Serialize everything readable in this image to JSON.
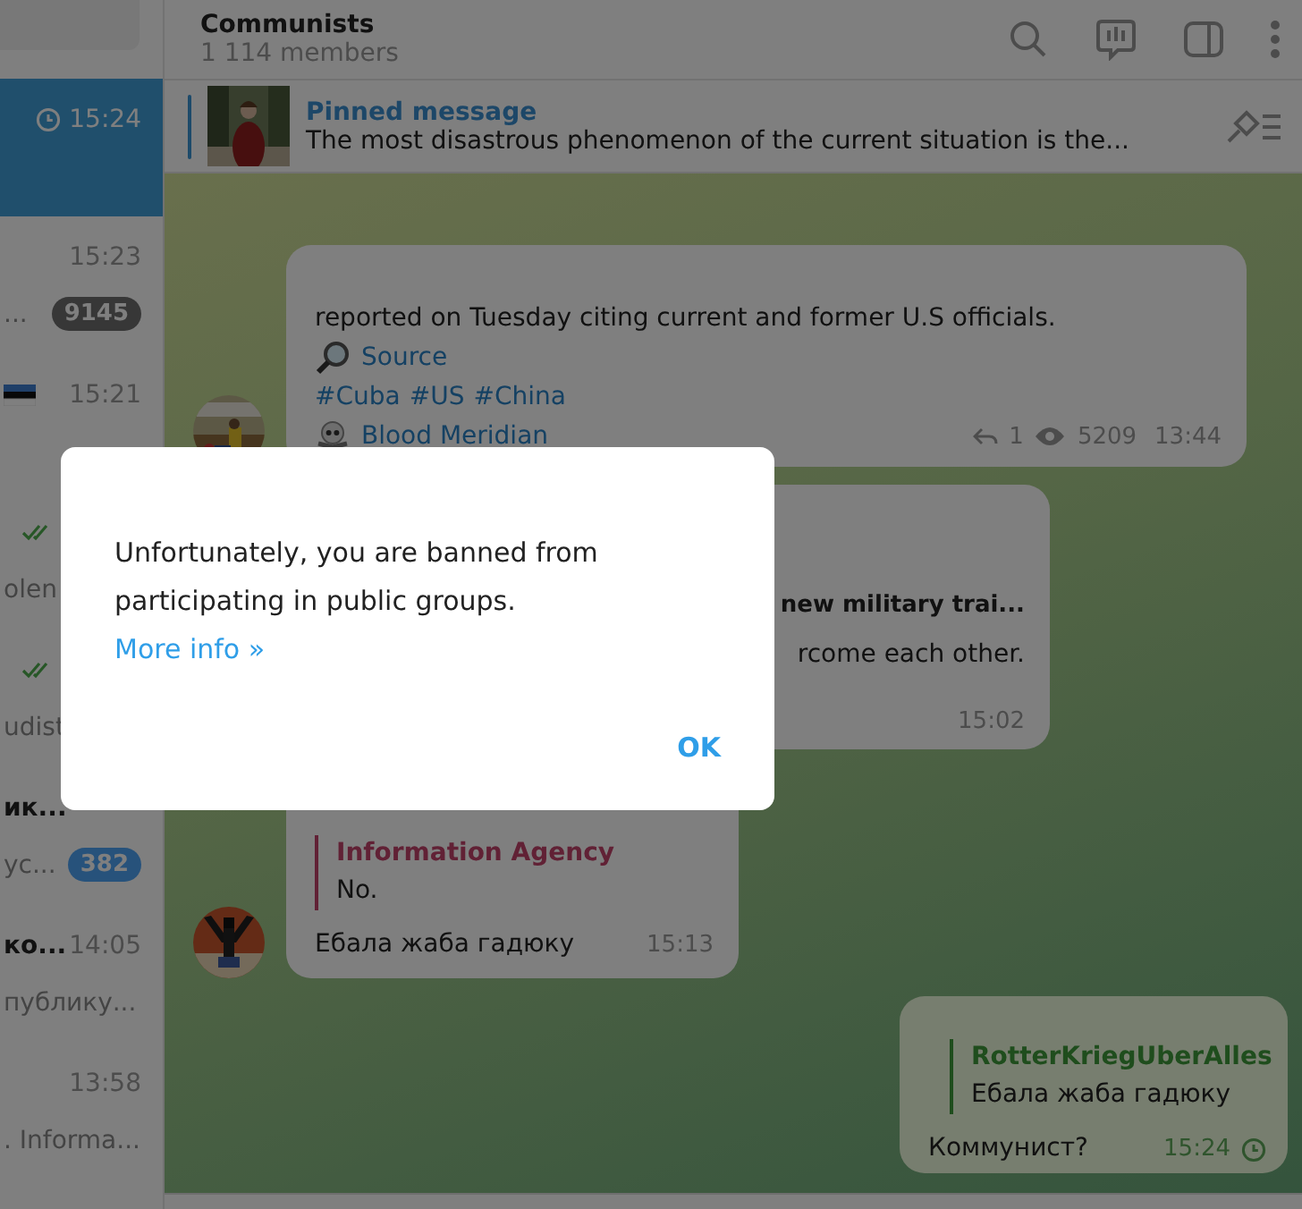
{
  "header": {
    "title": "Communists",
    "subtitle": "1 114 members"
  },
  "chats": [
    {
      "time": "15:24",
      "pending": true,
      "read": false,
      "flag": false,
      "selected": true
    },
    {
      "time": "15:23",
      "preview": "...",
      "badge": "9145",
      "muted": true,
      "pending": false,
      "read": false,
      "flag": false,
      "selected": false
    },
    {
      "time": "15:21",
      "pending": false,
      "read": false,
      "flag": true,
      "selected": false
    },
    {
      "preview": "olen",
      "pending": false,
      "read": true,
      "flag": false,
      "selected": false
    },
    {
      "preview": "udist",
      "pending": false,
      "read": true,
      "flag": false,
      "selected": false
    },
    {
      "name": "ик...",
      "preview": "ус...",
      "badge": "382",
      "muted": false,
      "pending": false,
      "read": false,
      "flag": false,
      "selected": false
    },
    {
      "name": "ко...",
      "time": "14:05",
      "preview": "публику...",
      "pending": false,
      "read": false,
      "flag": false,
      "selected": false
    },
    {
      "time": "13:58",
      "preview": ". Informa...",
      "pending": false,
      "read": false,
      "flag": false,
      "selected": false
    }
  ],
  "pinned": {
    "label": "Pinned message",
    "text": "The most disastrous phenomenon of the current situation is the..."
  },
  "messages": [
    {
      "kind": "post",
      "avatar": true,
      "text": "reported on Tuesday citing current and former U.S officials.",
      "source": "Source",
      "tags": [
        "#Cuba",
        "#US",
        "#China"
      ],
      "signature": "Blood Meridian",
      "replies": "1",
      "views": "5209",
      "time": "13:44"
    },
    {
      "kind": "preview",
      "avatar": false,
      "title": "new military trai...",
      "text": "rcome each other.",
      "time": "15:02"
    },
    {
      "kind": "reply",
      "avatar": true,
      "reply_name": "Information Agency",
      "reply_text": "No.",
      "text": "Ебала жаба гадюку",
      "time": "15:13"
    },
    {
      "kind": "outgoing",
      "reply_name": "RotterKriegUberAlles",
      "reply_text": "Ебала жаба гадюку",
      "text": "Коммунист?",
      "time": "15:24",
      "pending": true
    }
  ],
  "dialog": {
    "text": "Unfortunately, you are banned from participating in public groups.",
    "link": "More info »",
    "button": "OK"
  }
}
